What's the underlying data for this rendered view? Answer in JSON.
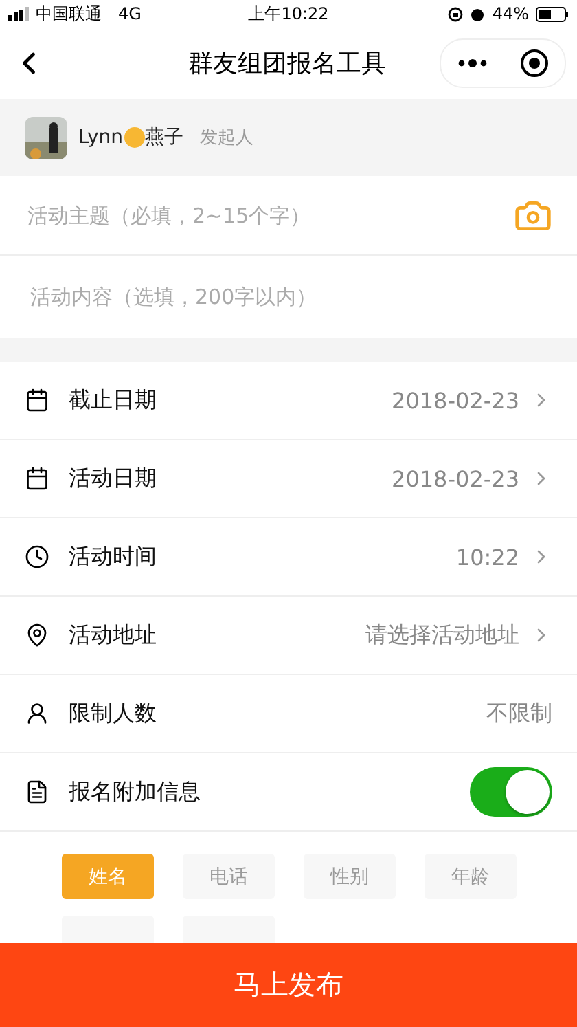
{
  "status_bar": {
    "carrier": "中国联通",
    "network": "4G",
    "time": "上午10:22",
    "battery": "44%"
  },
  "nav": {
    "title": "群友组团报名工具"
  },
  "organizer": {
    "name_before": "Lynn",
    "name_after": "燕子",
    "role": "发起人"
  },
  "topic_field": {
    "placeholder": "活动主题（必填，2~15个字）"
  },
  "content_field": {
    "placeholder": "活动内容（选填，200字以内）"
  },
  "rows": [
    {
      "kind": "link",
      "label": "截止日期",
      "value": "2018-02-23"
    },
    {
      "kind": "link",
      "label": "活动日期",
      "value": "2018-02-23"
    },
    {
      "kind": "link",
      "label": "活动时间",
      "value": "10:22"
    },
    {
      "kind": "link",
      "label": "活动地址",
      "value": "请选择活动地址"
    },
    {
      "kind": "value",
      "label": "限制人数",
      "value": "不限制"
    },
    {
      "kind": "toggle",
      "label": "报名附加信息",
      "on": true
    }
  ],
  "tags": [
    {
      "label": "姓名",
      "selected": true
    },
    {
      "label": "电话",
      "selected": false
    },
    {
      "label": "性别",
      "selected": false
    },
    {
      "label": "年龄",
      "selected": false
    }
  ],
  "publish_button": "马上发布"
}
